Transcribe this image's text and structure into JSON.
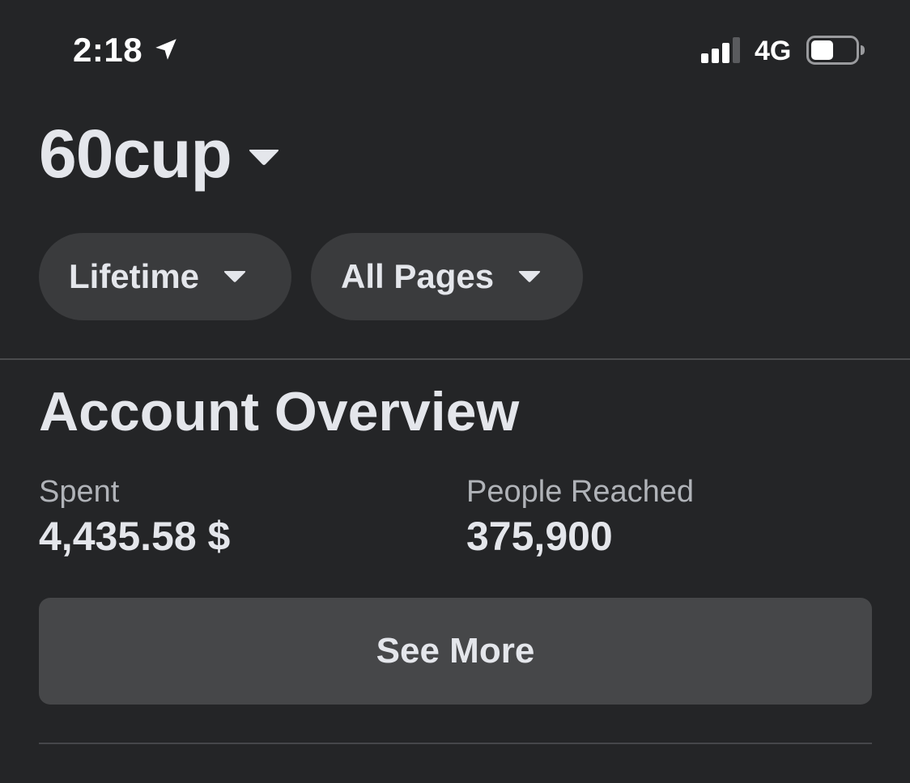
{
  "status_bar": {
    "time": "2:18",
    "network": "4G",
    "signal_bars_active": 3,
    "signal_bars_total": 4,
    "battery_level": 0.5,
    "icons": [
      "location-arrow-icon",
      "signal-icon",
      "battery-icon"
    ]
  },
  "account": {
    "name": "60cup"
  },
  "filters": {
    "time_range": "Lifetime",
    "pages": "All Pages"
  },
  "overview": {
    "title": "Account Overview",
    "spent_label": "Spent",
    "spent_value": "4,435.58 $",
    "reach_label": "People Reached",
    "reach_value": "375,900",
    "see_more_label": "See More"
  },
  "colors": {
    "background": "#242527",
    "chip": "#3a3b3d",
    "button": "#464749",
    "text_primary": "#e4e6eb",
    "text_secondary": "#b0b3b8"
  }
}
